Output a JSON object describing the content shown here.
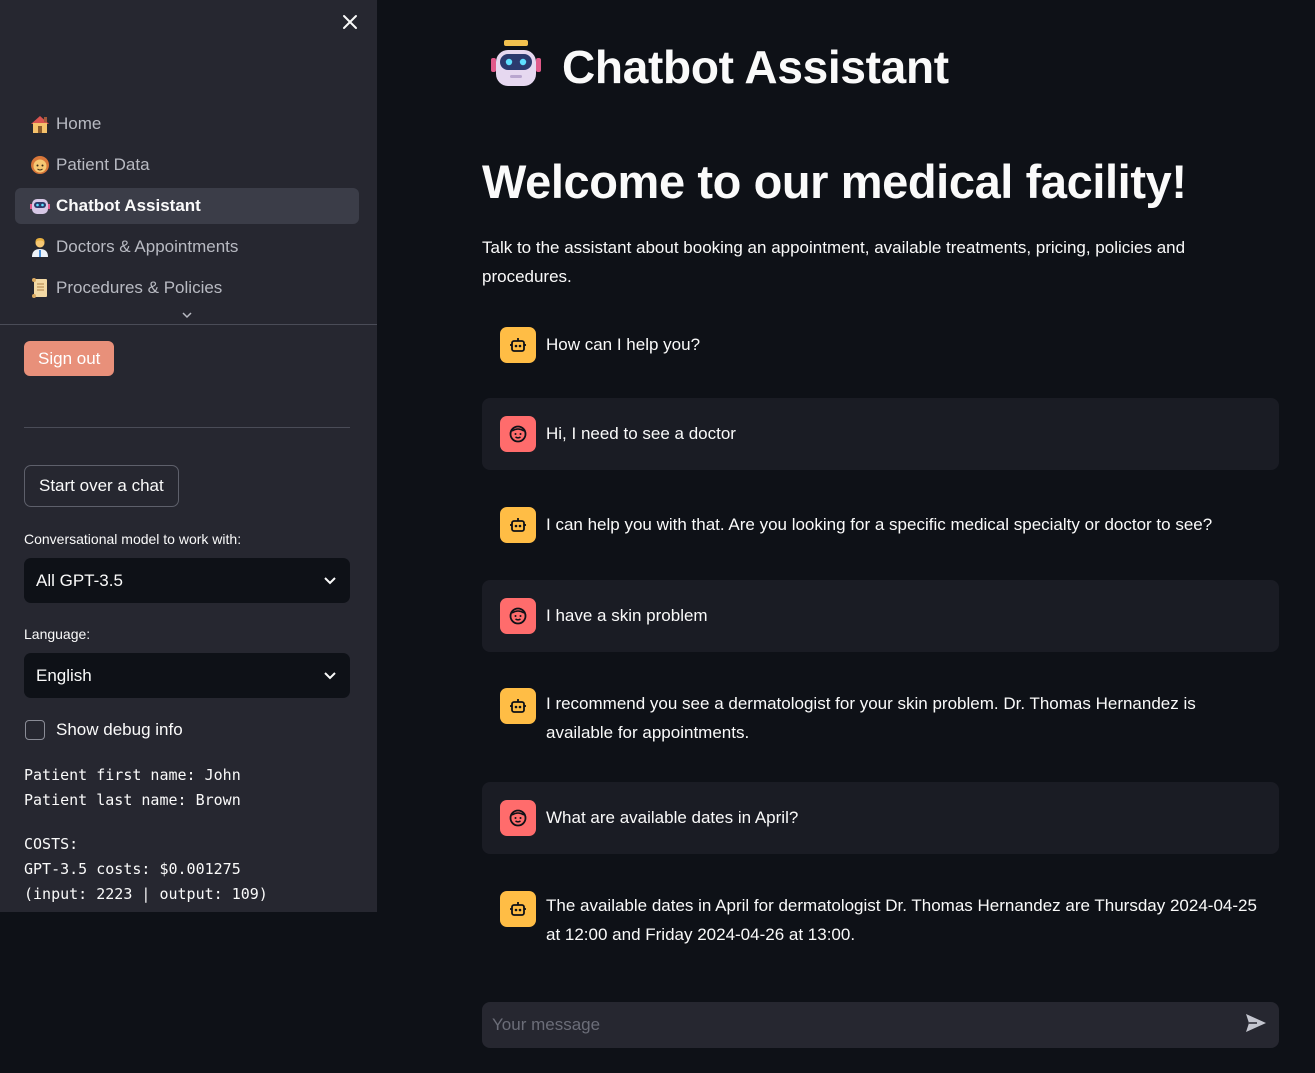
{
  "sidebar": {
    "nav": [
      {
        "label": "Home",
        "icon": "house-emoji-icon"
      },
      {
        "label": "Patient Data",
        "icon": "person-emoji-icon"
      },
      {
        "label": "Chatbot Assistant",
        "icon": "robot-emoji-icon",
        "active": true
      },
      {
        "label": "Doctors & Appointments",
        "icon": "doctor-emoji-icon"
      },
      {
        "label": "Procedures & Policies",
        "icon": "scroll-emoji-icon"
      }
    ],
    "sign_out": "Sign out",
    "start_over": "Start over a chat",
    "model_label": "Conversational model to work with:",
    "model_value": "All GPT-3.5",
    "language_label": "Language:",
    "language_value": "English",
    "debug_label": "Show debug info",
    "debug_checked": false,
    "patient_first": "Patient first name: John",
    "patient_last": "Patient last name: Brown",
    "costs_header": "COSTS:",
    "costs_line": "GPT-3.5 costs: $0.001275",
    "costs_detail": "(input: 2223 | output: 109)"
  },
  "main": {
    "title": "Chatbot Assistant",
    "welcome": "Welcome to our medical facility!",
    "intro": "Talk to the assistant about booking an appointment, available treatments, pricing, policies and procedures.",
    "messages": [
      {
        "role": "assistant",
        "text": "How can I help you?"
      },
      {
        "role": "user",
        "text": "Hi, I need to see a doctor"
      },
      {
        "role": "assistant",
        "text": "I can help you with that. Are you looking for a specific medical specialty or doctor to see?"
      },
      {
        "role": "user",
        "text": "I have a skin problem"
      },
      {
        "role": "assistant",
        "text": "I recommend you see a dermatologist for your skin problem. Dr. Thomas Hernandez is available for appointments."
      },
      {
        "role": "user",
        "text": "What are available dates in April?"
      },
      {
        "role": "assistant",
        "text": "The available dates in April for dermatologist Dr. Thomas Hernandez are Thursday 2024-04-25 at 12:00 and Friday 2024-04-26 at 13:00."
      }
    ],
    "input_placeholder": "Your message"
  },
  "colors": {
    "background": "#0e1117",
    "sidebar": "#262730",
    "assistant_avatar": "#ffbd45",
    "user_avatar": "#ff6c6c",
    "sign_out_button": "#e8907a"
  }
}
